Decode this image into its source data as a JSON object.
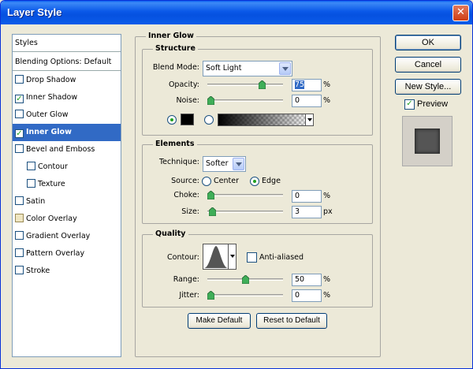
{
  "window": {
    "title": "Layer Style",
    "close_glyph": "✕"
  },
  "styles_panel": {
    "items": [
      {
        "label": "Styles",
        "type": "header"
      },
      {
        "label": "Blending Options: Default",
        "type": "header"
      },
      {
        "label": "Drop Shadow",
        "checked": false
      },
      {
        "label": "Inner Shadow",
        "checked": true
      },
      {
        "label": "Outer Glow",
        "checked": false
      },
      {
        "label": "Inner Glow",
        "checked": true,
        "selected": true
      },
      {
        "label": "Bevel and Emboss",
        "checked": false
      },
      {
        "label": "Contour",
        "checked": false,
        "indent": true
      },
      {
        "label": "Texture",
        "checked": false,
        "indent": true
      },
      {
        "label": "Satin",
        "checked": false
      },
      {
        "label": "Color Overlay",
        "checked": false,
        "tan": true
      },
      {
        "label": "Gradient Overlay",
        "checked": false
      },
      {
        "label": "Pattern Overlay",
        "checked": false
      },
      {
        "label": "Stroke",
        "checked": false
      }
    ]
  },
  "inner_glow": {
    "title": "Inner Glow",
    "structure": {
      "title": "Structure",
      "blend_mode_label": "Blend Mode:",
      "blend_mode_value": "Soft Light",
      "opacity_label": "Opacity:",
      "opacity_value": "75",
      "opacity_unit": "%",
      "opacity_level": 0.75,
      "noise_label": "Noise:",
      "noise_value": "0",
      "noise_unit": "%",
      "noise_level": 0,
      "glow_color": "#000000",
      "color_radio_selected": true
    },
    "elements": {
      "title": "Elements",
      "technique_label": "Technique:",
      "technique_value": "Softer",
      "source_label": "Source:",
      "source_center": "Center",
      "source_edge": "Edge",
      "source_selected": "Edge",
      "choke_label": "Choke:",
      "choke_value": "0",
      "choke_unit": "%",
      "choke_level": 0,
      "size_label": "Size:",
      "size_value": "3",
      "size_unit": "px",
      "size_level": 0.02
    },
    "quality": {
      "title": "Quality",
      "contour_label": "Contour:",
      "anti_aliased_label": "Anti-aliased",
      "anti_aliased_checked": false,
      "range_label": "Range:",
      "range_value": "50",
      "range_unit": "%",
      "range_level": 0.5,
      "jitter_label": "Jitter:",
      "jitter_value": "0",
      "jitter_unit": "%",
      "jitter_level": 0
    },
    "make_default_label": "Make Default",
    "reset_default_label": "Reset to Default"
  },
  "actions": {
    "ok_label": "OK",
    "cancel_label": "Cancel",
    "new_style_label": "New Style...",
    "preview_label": "Preview",
    "preview_checked": true
  },
  "colors": {
    "selection": "#316ac5",
    "titlebar": "#0a5ce9",
    "dialog_bg": "#ece9d8",
    "check_green": "#21a121"
  }
}
